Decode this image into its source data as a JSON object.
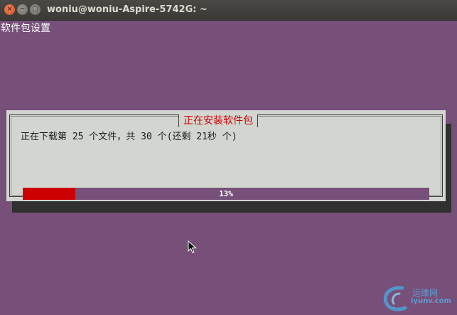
{
  "window": {
    "title": "woniu@woniu-Aspire-5742G: ~",
    "buttons": {
      "close": "×",
      "minimize": "−",
      "maximize": "□"
    }
  },
  "terminal": {
    "background_title": "软件包设置"
  },
  "dialog": {
    "title": "正在安装软件包",
    "status_text": "正在下载第 25 个文件，共 30 个(还剩 21秒 个)",
    "progress": {
      "percent": 13,
      "label": "13%"
    }
  },
  "watermark": {
    "text": "运维网",
    "subtext": "iyunv.com"
  },
  "colors": {
    "terminal_bg": "#77507a",
    "dialog_bg": "#d3d6d0",
    "accent_red": "#cc0000",
    "titlebar": "#3c3b37"
  },
  "icons": {
    "close": "close-icon",
    "minimize": "minimize-icon",
    "maximize": "maximize-icon",
    "cursor": "mouse-cursor-icon",
    "watermark_logo": "watermark-logo-icon"
  }
}
